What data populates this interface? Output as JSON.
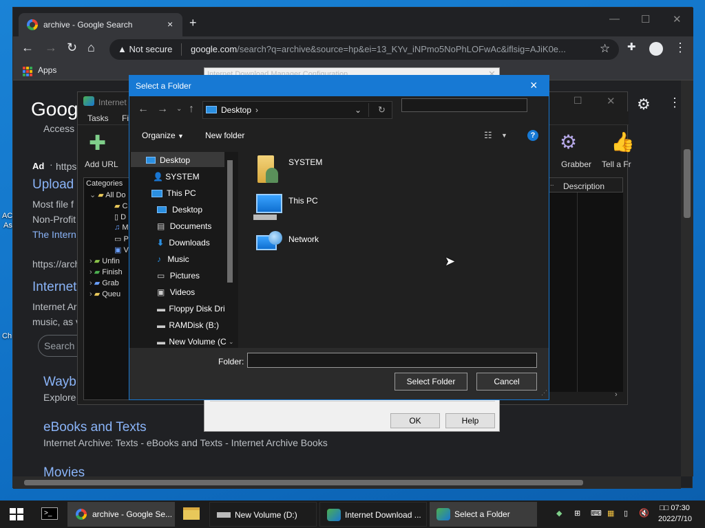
{
  "desktop": {
    "labels": [
      "AC",
      "As",
      "Ch"
    ]
  },
  "browser": {
    "tab_title": "archive - Google Search",
    "tab_close": "×",
    "new_tab": "+",
    "not_secure": "Not secure",
    "url_host": "google.com",
    "url_rest": "/search?q=archive&source=hp&ei=13_KYv_iNPmo5NoPhLOFwAc&iflsig=AJiK0e...",
    "bookmarks_apps": "Apps",
    "results": {
      "logo_fragment": "Googl",
      "access_fragment": "Access",
      "ad_label": "Ad",
      "ad_url_fragment": "https:",
      "upload_fragment": "Upload",
      "snippet1": "Most file f",
      "snippet2": "Non-Profit",
      "snippet3": "The Intern",
      "url2_fragment": "https://arch",
      "internet_fragment": "Internet",
      "snippet4": "Internet Ar",
      "snippet5": "music, as v",
      "search_fragment": "Search a",
      "wayback_fragment": "Wayb",
      "explore_fragment": "Explore",
      "ebooks_title": "eBooks and Texts",
      "ebooks_desc": "Internet Archive: Texts - eBooks and Texts - Internet Archive Books",
      "movies_title": "Movies"
    }
  },
  "idm": {
    "title": "Internet",
    "menu": [
      "Tasks",
      "Fi"
    ],
    "toolbar": {
      "add_url": "Add URL",
      "grabber": "Grabber",
      "tell": "Tell a Fr"
    },
    "categories_header": "Categories",
    "categories": [
      "All Do",
      "C",
      "D",
      "M",
      "P",
      "V",
      "Unfin",
      "Finish",
      "Grab",
      "Queu"
    ],
    "column_description": "Description"
  },
  "config_dialog": {
    "title": "Internet Download Manager Configuration",
    "ok": "OK",
    "help": "Help"
  },
  "select_folder": {
    "title": "Select a Folder",
    "close": "×",
    "breadcrumb": "Desktop",
    "organize": "Organize",
    "new_folder": "New folder",
    "help": "?",
    "nav_items": [
      "Desktop",
      "SYSTEM",
      "This PC",
      "Desktop",
      "Documents",
      "Downloads",
      "Music",
      "Pictures",
      "Videos",
      "Floppy Disk Dri",
      "RAMDisk (B:)",
      "New Volume (C"
    ],
    "main_items": [
      "SYSTEM",
      "This PC",
      "Network"
    ],
    "folder_label": "Folder:",
    "folder_value": "",
    "select_button": "Select Folder",
    "cancel_button": "Cancel"
  },
  "taskbar": {
    "items": [
      "archive - Google Se...",
      "New Volume (D:)",
      "Internet Download ...",
      "Select a Folder"
    ],
    "time": "07:30",
    "time_prefix": "□□",
    "date": "2022/7/10"
  }
}
